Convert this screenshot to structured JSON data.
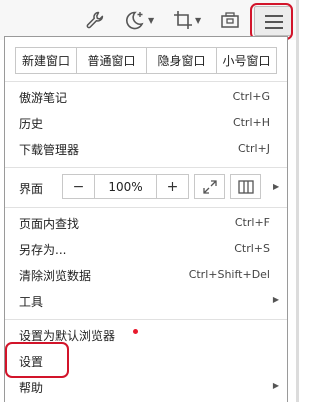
{
  "toolbar": {
    "icons": [
      "wrench-icon",
      "moon-plus-icon",
      "crop-icon",
      "screenshot-camera-icon",
      "hamburger-menu-icon"
    ],
    "dropdown_arrow": "▼"
  },
  "menu": {
    "window_buttons": [
      "新建窗口",
      "普通窗口",
      "隐身窗口",
      "小号窗口"
    ],
    "group1": [
      {
        "label": "傲游笔记",
        "shortcut": "Ctrl+G"
      },
      {
        "label": "历史",
        "shortcut": "Ctrl+H"
      },
      {
        "label": "下载管理器",
        "shortcut": "Ctrl+J"
      }
    ],
    "interface_label": "界面",
    "zoom": {
      "minus": "−",
      "value": "100%",
      "plus": "+"
    },
    "group2": [
      {
        "label": "页面内查找",
        "shortcut": "Ctrl+F"
      },
      {
        "label": "另存为...",
        "shortcut": "Ctrl+S"
      },
      {
        "label": "清除浏览数据",
        "shortcut": "Ctrl+Shift+Del"
      },
      {
        "label": "工具",
        "shortcut": ""
      }
    ],
    "set_default": "设置为默认浏览器",
    "settings": "设置",
    "help": "帮助",
    "submenu_arrow": "▶"
  },
  "colors": {
    "highlight_ring": "#d2142a",
    "notification_dot": "#e8192c"
  }
}
